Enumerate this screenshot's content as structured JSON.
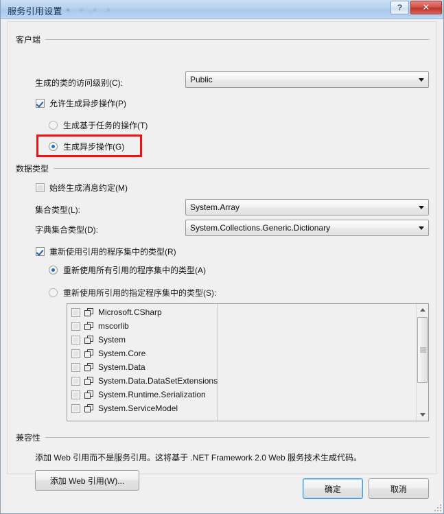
{
  "window": {
    "title": "服务引用设置",
    "help_button": "?",
    "close_button": "✕"
  },
  "client_group": {
    "label": "客户端",
    "access_level_label": "生成的类的访问级别(C):",
    "access_level_value": "Public",
    "allow_async_label": "允许生成异步操作(P)",
    "allow_async_checked": true,
    "task_based_label": "生成基于任务的操作(T)",
    "task_based_selected": false,
    "async_label": "生成异步操作(G)",
    "async_selected": true
  },
  "data_types_group": {
    "label": "数据类型",
    "always_message_contracts_label": "始终生成消息约定(M)",
    "always_message_contracts_checked": false,
    "collection_type_label": "集合类型(L):",
    "collection_type_value": "System.Array",
    "dictionary_type_label": "字典集合类型(D):",
    "dictionary_type_value": "System.Collections.Generic.Dictionary",
    "reuse_types_label": "重新使用引用的程序集中的类型(R)",
    "reuse_types_checked": true,
    "reuse_all_label": "重新使用所有引用的程序集中的类型(A)",
    "reuse_all_selected": true,
    "reuse_specified_label": "重新使用所引用的指定程序集中的类型(S):",
    "reuse_specified_selected": false,
    "assemblies": [
      {
        "name": "Microsoft.CSharp",
        "checked": false
      },
      {
        "name": "mscorlib",
        "checked": false
      },
      {
        "name": "System",
        "checked": false
      },
      {
        "name": "System.Core",
        "checked": false
      },
      {
        "name": "System.Data",
        "checked": false
      },
      {
        "name": "System.Data.DataSetExtensions",
        "checked": false
      },
      {
        "name": "System.Runtime.Serialization",
        "checked": false
      },
      {
        "name": "System.ServiceModel",
        "checked": false
      }
    ]
  },
  "compatibility_group": {
    "label": "兼容性",
    "description": "添加 Web 引用而不是服务引用。这将基于 .NET Framework 2.0 Web 服务技术生成代码。",
    "add_web_reference_button": "添加 Web 引用(W)..."
  },
  "footer": {
    "ok_button": "确定",
    "cancel_button": "取消"
  },
  "colors": {
    "highlight": "#ee1111",
    "titlebar": "#b0ceee",
    "body_bg": "#f0f0f0",
    "close_button": "#c33c33",
    "focus_border": "#3c9ade"
  }
}
